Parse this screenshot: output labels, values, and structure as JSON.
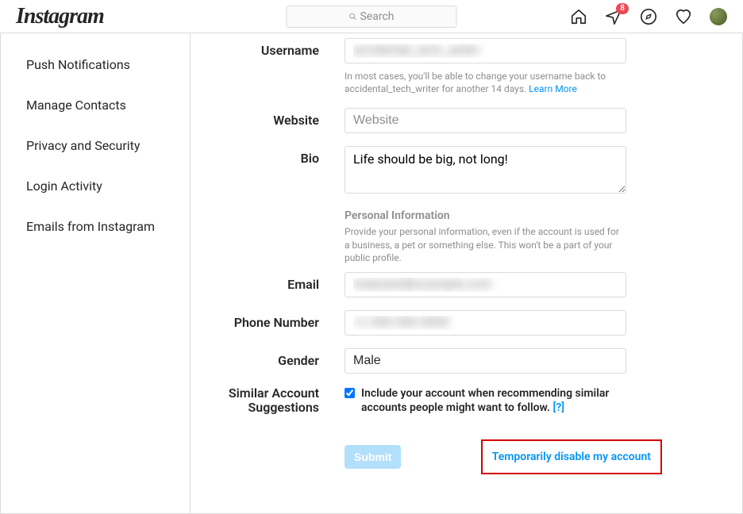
{
  "brand": "Instagram",
  "search": {
    "placeholder": "Search"
  },
  "badge_count": "8",
  "sidebar": {
    "items": [
      {
        "label": "Push Notifications"
      },
      {
        "label": "Manage Contacts"
      },
      {
        "label": "Privacy and Security"
      },
      {
        "label": "Login Activity"
      },
      {
        "label": "Emails from Instagram"
      }
    ]
  },
  "form": {
    "username_label": "Username",
    "username_value": "accidental_tech_writer",
    "username_help_prefix": "In most cases, you'll be able to change your username back to accidental_tech_writer for another 14 days. ",
    "username_help_link": "Learn More",
    "website_label": "Website",
    "website_placeholder": "Website",
    "bio_label": "Bio",
    "bio_value": "Life should be big, not long!",
    "pi_title": "Personal Information",
    "pi_desc": "Provide your personal information, even if the account is used for a business, a pet or something else. This won't be a part of your public profile.",
    "email_label": "Email",
    "email_value": "redacted@example.com",
    "phone_label": "Phone Number",
    "phone_value": "+1 000 000 0000",
    "gender_label": "Gender",
    "gender_value": "Male",
    "similar_label_l1": "Similar Account",
    "similar_label_l2": "Suggestions",
    "similar_checkbox_label": "Include your account when recommending similar accounts people might want to follow.  ",
    "similar_help_link": "[?]",
    "submit_label": "Submit",
    "disable_label": "Temporarily disable my account"
  }
}
